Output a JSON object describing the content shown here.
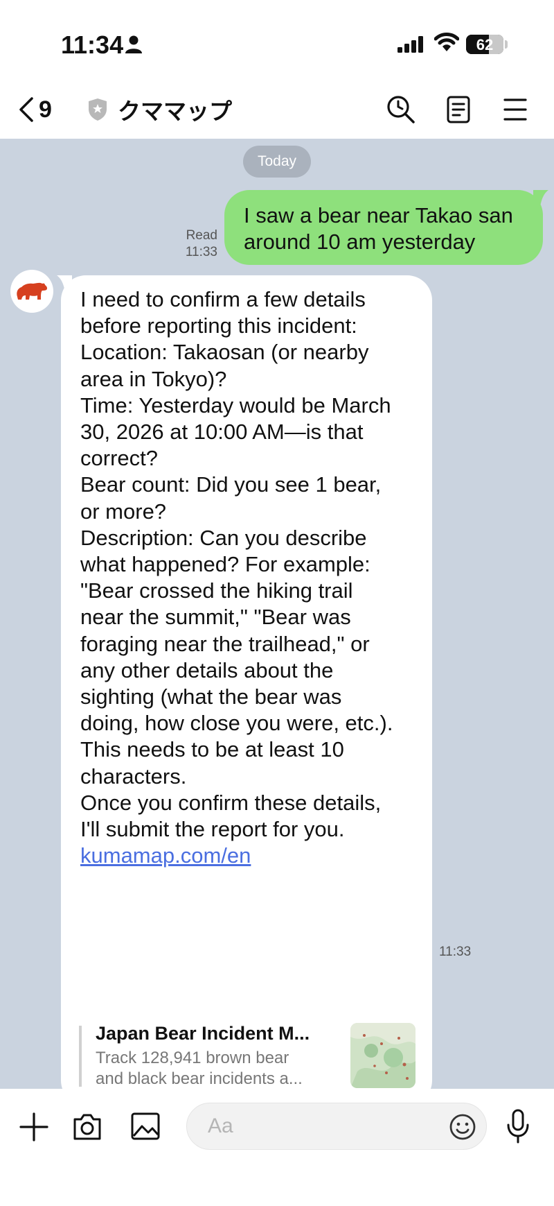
{
  "status_bar": {
    "time": "11:34",
    "battery_level": "62",
    "battery_fraction": 0.62
  },
  "header": {
    "back_count": "9",
    "title": "クママップ",
    "icons": [
      "back-chevron-icon",
      "shield-icon",
      "search-icon",
      "notes-icon",
      "menu-icon"
    ]
  },
  "chat": {
    "date_divider": "Today",
    "sent_message": {
      "lines": [
        "I saw a bear near Takao san",
        "around 10 am yesterday"
      ],
      "status": "Read",
      "time": "11:33"
    },
    "received_message": {
      "lines": [
        "I need to confirm a few details",
        "before reporting this incident:",
        "Location: Takaosan (or nearby",
        "area in Tokyo)?",
        "Time: Yesterday would be March",
        "30, 2026 at 10:00 AM—is that",
        "correct?",
        "Bear count: Did you see 1 bear,",
        "or more?",
        "Description: Can you describe",
        "what happened? For example:",
        "\"Bear crossed the hiking trail",
        "near the summit,\" \"Bear was",
        "foraging near the trailhead,\" or",
        "any other details about the",
        "sighting (what the bear was",
        "doing, how close you were, etc.).",
        "This needs to be at least 10",
        "characters.",
        "Once you confirm these details,",
        "I'll submit the report for you."
      ],
      "link": "kumamap.com/en",
      "preview": {
        "title": "Japan Bear Incident M...",
        "description_lines": [
          "Track 128,941 brown bear",
          "and black bear incidents a..."
        ]
      },
      "time": "11:33"
    }
  },
  "composer": {
    "placeholder": "Aa",
    "icons": [
      "plus-icon",
      "camera-icon",
      "image-icon",
      "emoji-icon",
      "microphone-icon"
    ]
  },
  "colors": {
    "chat_background": "#cad3df",
    "sent_bubble": "#8ee07c",
    "received_bubble": "#ffffff",
    "link": "#4a6ee0",
    "bear_avatar": "#d6401f"
  }
}
